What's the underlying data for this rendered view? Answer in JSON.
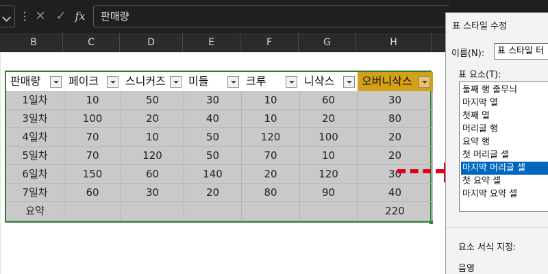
{
  "formula_bar": {
    "cell_value": "판매량",
    "fx_label": "fx"
  },
  "columns": [
    "B",
    "C",
    "D",
    "E",
    "F",
    "G",
    "H"
  ],
  "table": {
    "headers": [
      "판매량",
      "페이크",
      "스니커즈",
      "미들",
      "크루",
      "니삭스",
      "오버니삭스"
    ],
    "rows": [
      [
        "1일차",
        "10",
        "50",
        "30",
        "10",
        "60",
        "30"
      ],
      [
        "3일차",
        "100",
        "20",
        "40",
        "10",
        "20",
        "80"
      ],
      [
        "4일차",
        "70",
        "10",
        "50",
        "120",
        "100",
        "20"
      ],
      [
        "5일차",
        "70",
        "120",
        "50",
        "70",
        "10",
        "20"
      ],
      [
        "6일차",
        "150",
        "60",
        "140",
        "20",
        "120",
        "30"
      ],
      [
        "7일차",
        "60",
        "30",
        "20",
        "80",
        "90",
        "40"
      ],
      [
        "요약",
        "",
        "",
        "",
        "",
        "",
        "220"
      ]
    ],
    "highlight_header_color": "#d4a017",
    "border_color": "#2e7d32"
  },
  "dialog": {
    "title": "표 스타일 수정",
    "name_label": "이름(N):",
    "name_value": "표 스타일 터",
    "elements_label": "표 요소(T):",
    "elements": [
      "둘째 행 줄무늬",
      "마지막 열",
      "첫째 열",
      "머리글 행",
      "요약 행",
      "첫 머리글 셀",
      "마지막 머리글 셀",
      "첫 요약 셀",
      "마지막 요약 셀"
    ],
    "selected_element": "마지막 머리글 셀",
    "format_label": "요소 서식 지정:",
    "shading_label": "음영"
  },
  "annotation": {
    "arrow_color": "#e0001a"
  }
}
